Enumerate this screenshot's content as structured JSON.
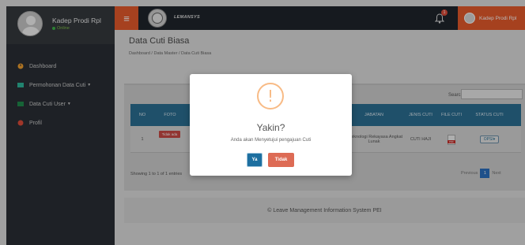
{
  "user": {
    "name": "Kadep Prodi Rpl",
    "status": "Online"
  },
  "menu": {
    "items": [
      {
        "label": "Dashboard",
        "icon": "dashboard-icon",
        "has_caret": false,
        "color": "#f0a030"
      },
      {
        "label": "Permohonan Data Cuti",
        "icon": "list-icon",
        "has_caret": true,
        "color": "#2fb69a"
      },
      {
        "label": "Data Cuti User",
        "icon": "folder-icon",
        "has_caret": true,
        "color": "#1f8a4c"
      },
      {
        "label": "Profil",
        "icon": "profile-icon",
        "has_caret": false,
        "color": "#dd4b39"
      }
    ]
  },
  "header": {
    "app_title": "LEMANSYS",
    "notification_count": "1",
    "user_name": "Kadep Prodi Rpl"
  },
  "page": {
    "title": "Data Cuti Biasa",
    "breadcrumb": "Dashboard / Data Master / Data Cuti Biasa"
  },
  "table": {
    "search_label": "Search:",
    "headers": {
      "no": "NO",
      "foto": "FOTO",
      "jabatan": "JABATAN",
      "jenis_cuti": "JENIS CUTI",
      "file_cuti": "FILE CUTI",
      "status_cuti": "STATUS CUTI"
    },
    "rows": [
      {
        "no": "1",
        "foto_label": "Tidak ada",
        "jabatan": "e Teknologi Rekayasa Angkat Lunak",
        "jenis_cuti": "CUTI HAJI",
        "status_button": "OPSI"
      }
    ],
    "showing": "Showing 1 to 1 of 1 entries",
    "pager": {
      "prev": "Previous",
      "page": "1",
      "next": "Next"
    }
  },
  "footer": {
    "text": "Leave Management Information System PEI"
  },
  "modal": {
    "title": "Yakin?",
    "message": "Anda akan Menyetujui pengajuan Cuti",
    "confirm_label": "Ya",
    "cancel_label": "Tidak"
  },
  "colors": {
    "accent": "#e75a2c",
    "table_header": "#2b6f94",
    "confirm": "#1d6fa0",
    "cancel": "#dd6b55",
    "warning": "#f8bb86"
  }
}
